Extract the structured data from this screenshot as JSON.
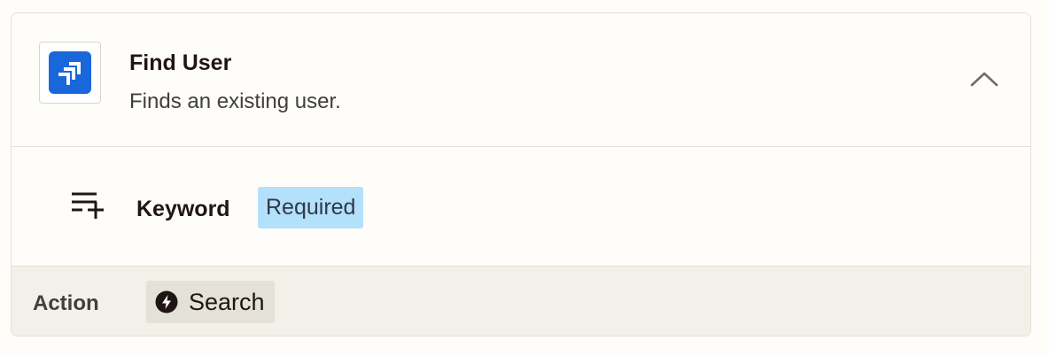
{
  "step": {
    "title": "Find User",
    "description": "Finds an existing user.",
    "app_icon": "jira-logo-icon",
    "collapse_icon": "chevron-up-icon"
  },
  "field": {
    "icon": "add-field-icon",
    "label": "Keyword",
    "badge": "Required"
  },
  "footer": {
    "label": "Action",
    "chip_icon": "bolt-icon",
    "chip_label": "Search"
  },
  "colors": {
    "brand": "#1868db",
    "required_badge_bg": "#b3e0fb",
    "footer_bg": "#f3f0e9"
  }
}
